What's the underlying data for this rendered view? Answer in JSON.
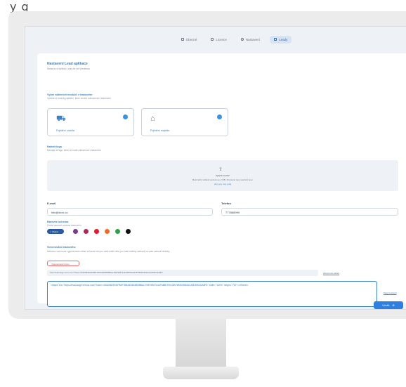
{
  "page": {
    "top_caption": "y g"
  },
  "nav": {
    "tabs": [
      {
        "label": "Obecné",
        "icon": "user-icon"
      },
      {
        "label": "Licence",
        "icon": "calendar-icon"
      },
      {
        "label": "Nastavení",
        "icon": "gear-icon"
      },
      {
        "label": "Leady",
        "icon": "users-icon",
        "active": true
      }
    ]
  },
  "header": {
    "title": "Nastavení Lead aplikace",
    "subtitle": "Nastavte si aplikaci Lead dle své představy"
  },
  "modules": {
    "title": "Vyber aktivních modulů v leadovém",
    "subtitle": "Vyberte si moduly pojištění, které chcete zobrazovat v leadovém",
    "items": [
      {
        "label": "Pojištění vozidla",
        "icon": "car-icon",
        "checked": true
      },
      {
        "label": "Pojištění majetku",
        "icon": "house-icon",
        "checked": true
      }
    ]
  },
  "logo": {
    "title": "Nahrát logo",
    "subtitle": "Nahrajte si logo, které se bude zobrazovat v leadovém",
    "line1": "Vyberte soubor",
    "line2": "Maximální velikost souboru je 2 MB. Povolené typy souborů jsou:",
    "line3": "png, jpg, svg, jpeg"
  },
  "contact": {
    "email_label": "E-mail",
    "email_value": "info@xxxx.cz",
    "phone_label": "Telefon",
    "phone_value": "777888999"
  },
  "colors": {
    "title": "Barevné schéma",
    "subtitle": "Zvolte barevné schéma leadového",
    "selected_label": "Modrá",
    "swatches": [
      "#2c5aa0",
      "#7b3a8e",
      "#b0265a",
      "#e01c2c",
      "#ef6a25",
      "#2f9e4a",
      "#111111"
    ]
  },
  "embed": {
    "title": "Generování leadového",
    "subtitle": "Nakonec vám bude vygenerován odkaz a iframe kód pro vaše další nebo pro vaše stránky webové na vaše webové stránky",
    "regenerate_label": "Vygenerovat znovu",
    "url": "https://lead.stage.versuz.com/?token=453D5B2E9DFBBF358A9D8D8B9BBAC7B579B57A44F6BB7E9443B76B9D69526CA6D69D32A8F8",
    "copy_link_label": "Zkopírovat odkaz",
    "iframe_code": "<iframe src=\"https://lead.stage.versuz.com/?token=453D5B2E9DFBBF358A9D8D8B9BBAC7B579B57A44F6BB7E9443B76B9D69526CA6D69D32A8F8\" width=\"100%\" height=\"700\"></iframe>",
    "copy_code_label": "Zkopírovat kód"
  },
  "footer": {
    "save_label": "Uložit"
  }
}
